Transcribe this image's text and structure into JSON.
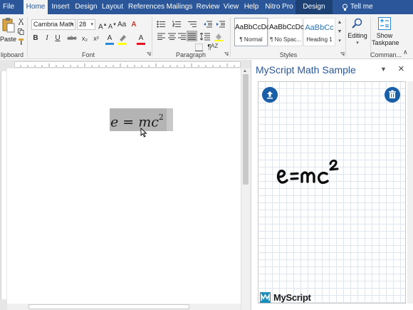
{
  "menu": {
    "items": [
      "File",
      "Home",
      "Insert",
      "Design",
      "Layout",
      "References",
      "Mailings",
      "Review",
      "View",
      "Help",
      "Nitro Pro",
      "Design"
    ],
    "tell_me": "Tell me",
    "active": "Home"
  },
  "ribbon": {
    "clipboard": {
      "paste_label": "Paste",
      "group_label": "lipboard"
    },
    "font": {
      "font_name": "Cambria Math",
      "font_size": "28",
      "group_label": "Font",
      "buttons": [
        "B",
        "I",
        "U",
        "abc",
        "x₂",
        "x²",
        "A",
        "A"
      ]
    },
    "paragraph": {
      "group_label": "Paragraph",
      "sort_label": "¶"
    },
    "styles": {
      "group_label": "Styles",
      "items": [
        {
          "preview": "AaBbCcDc",
          "name": "¶ Normal"
        },
        {
          "preview": "AaBbCcDc",
          "name": "¶ No Spac..."
        },
        {
          "preview": "AaBbCc",
          "name": "Heading 1"
        }
      ]
    },
    "editing": {
      "label": "Editing"
    },
    "commands": {
      "show_label": "Show",
      "taskpane_label": "Taskpane",
      "group_label": "Comman..."
    }
  },
  "document": {
    "equation": "e = mc",
    "exponent": "2"
  },
  "pane": {
    "title": "MyScript Math Sample",
    "handwriting": "e=mc²",
    "logo_text": "MyScript"
  },
  "colors": {
    "accent": "#2b579a",
    "button_blue": "#1a5ea8",
    "logo_teal": "#1b8fb9"
  }
}
